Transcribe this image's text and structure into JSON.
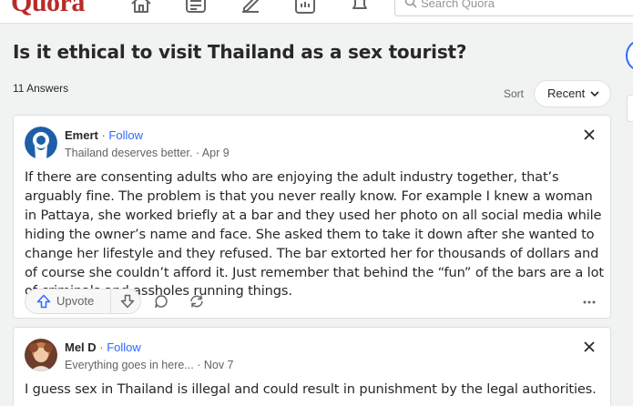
{
  "header": {
    "logo": "Quora",
    "search_placeholder": "Search Quora",
    "icons": [
      "home-icon",
      "following-icon",
      "answer-icon",
      "spaces-icon",
      "notifications-icon"
    ]
  },
  "question": {
    "title": "Is it ethical to visit Thailand as a sex tourist?",
    "answers_count": "11 Answers"
  },
  "sort": {
    "label": "Sort",
    "value": "Recent"
  },
  "answers": [
    {
      "author": "Emert",
      "follow": "Follow",
      "credential": "Thailand deserves better. · Apr 9",
      "text": "If there are consenting adults who are enjoying the adult industry together, that’s arguably fine. The problem is that you never really know. For example I knew a woman in Pattaya, she worked briefly at a bar and they used her photo on all social media while hiding the owner’s name and face. She asked them to take it down after she wanted to change her lifestyle and they refused. The bar extorted her for thousands of dollars and of course she couldn’t afford it. Just remember that behind the “fun” of the bars are a lot of criminals and assholes running things.",
      "upvote_label": "Upvote"
    },
    {
      "author": "Mel D",
      "follow": "Follow",
      "credential": "Everything goes in here... · Nov 7",
      "text": "I guess sex in Thailand is illegal and could result in punishment by the legal authorities."
    }
  ],
  "colors": {
    "brand": "#b92b27",
    "link": "#2e69ff",
    "text": "#282829",
    "muted": "#636466",
    "background": "#f1f2f2"
  }
}
